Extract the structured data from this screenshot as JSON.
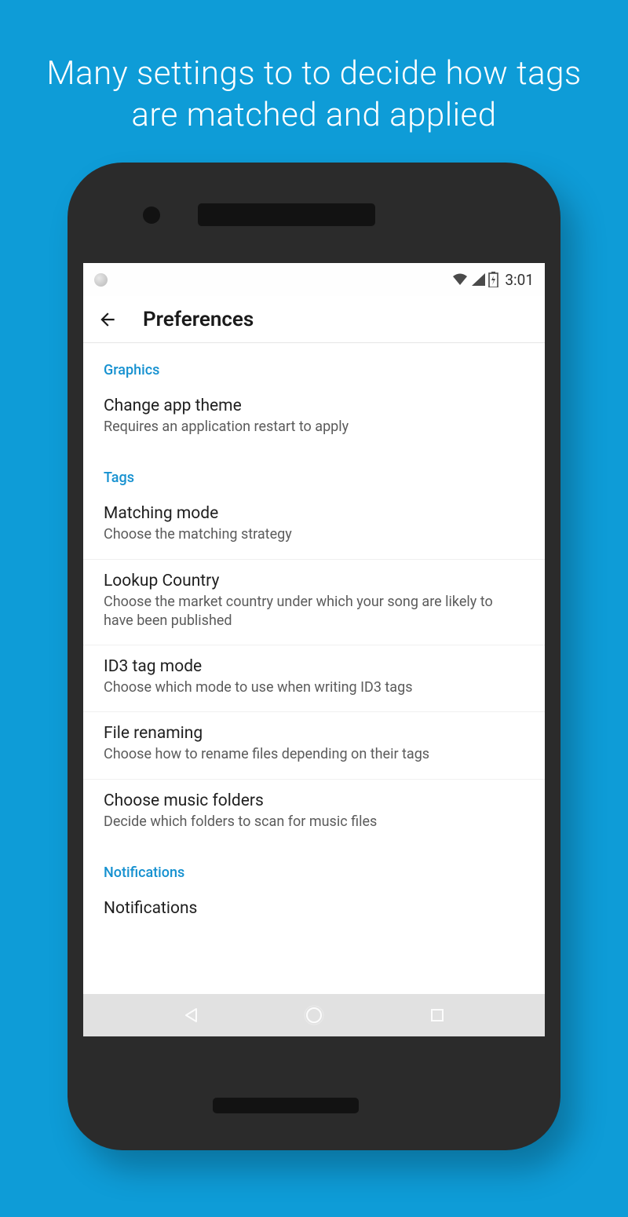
{
  "promo": {
    "text": "Many settings to to decide how tags are matched and applied"
  },
  "statusBar": {
    "time": "3:01"
  },
  "appBar": {
    "title": "Preferences"
  },
  "sections": [
    {
      "header": "Graphics",
      "items": [
        {
          "title": "Change app theme",
          "subtitle": "Requires an application restart to apply"
        }
      ]
    },
    {
      "header": "Tags",
      "items": [
        {
          "title": "Matching mode",
          "subtitle": "Choose the matching strategy"
        },
        {
          "title": "Lookup Country",
          "subtitle": "Choose the market country under which your song are likely to have been published"
        },
        {
          "title": "ID3 tag mode",
          "subtitle": "Choose which mode to use when writing ID3 tags"
        },
        {
          "title": "File renaming",
          "subtitle": "Choose how to rename files depending on their tags"
        },
        {
          "title": "Choose music folders",
          "subtitle": "Decide which folders to scan for music files"
        }
      ]
    },
    {
      "header": "Notifications",
      "items": [
        {
          "title": "Notifications",
          "subtitle": ""
        }
      ]
    }
  ],
  "colors": {
    "background": "#0e9cd7",
    "accent": "#1691d0",
    "phoneFrame": "#2b2b2b"
  }
}
